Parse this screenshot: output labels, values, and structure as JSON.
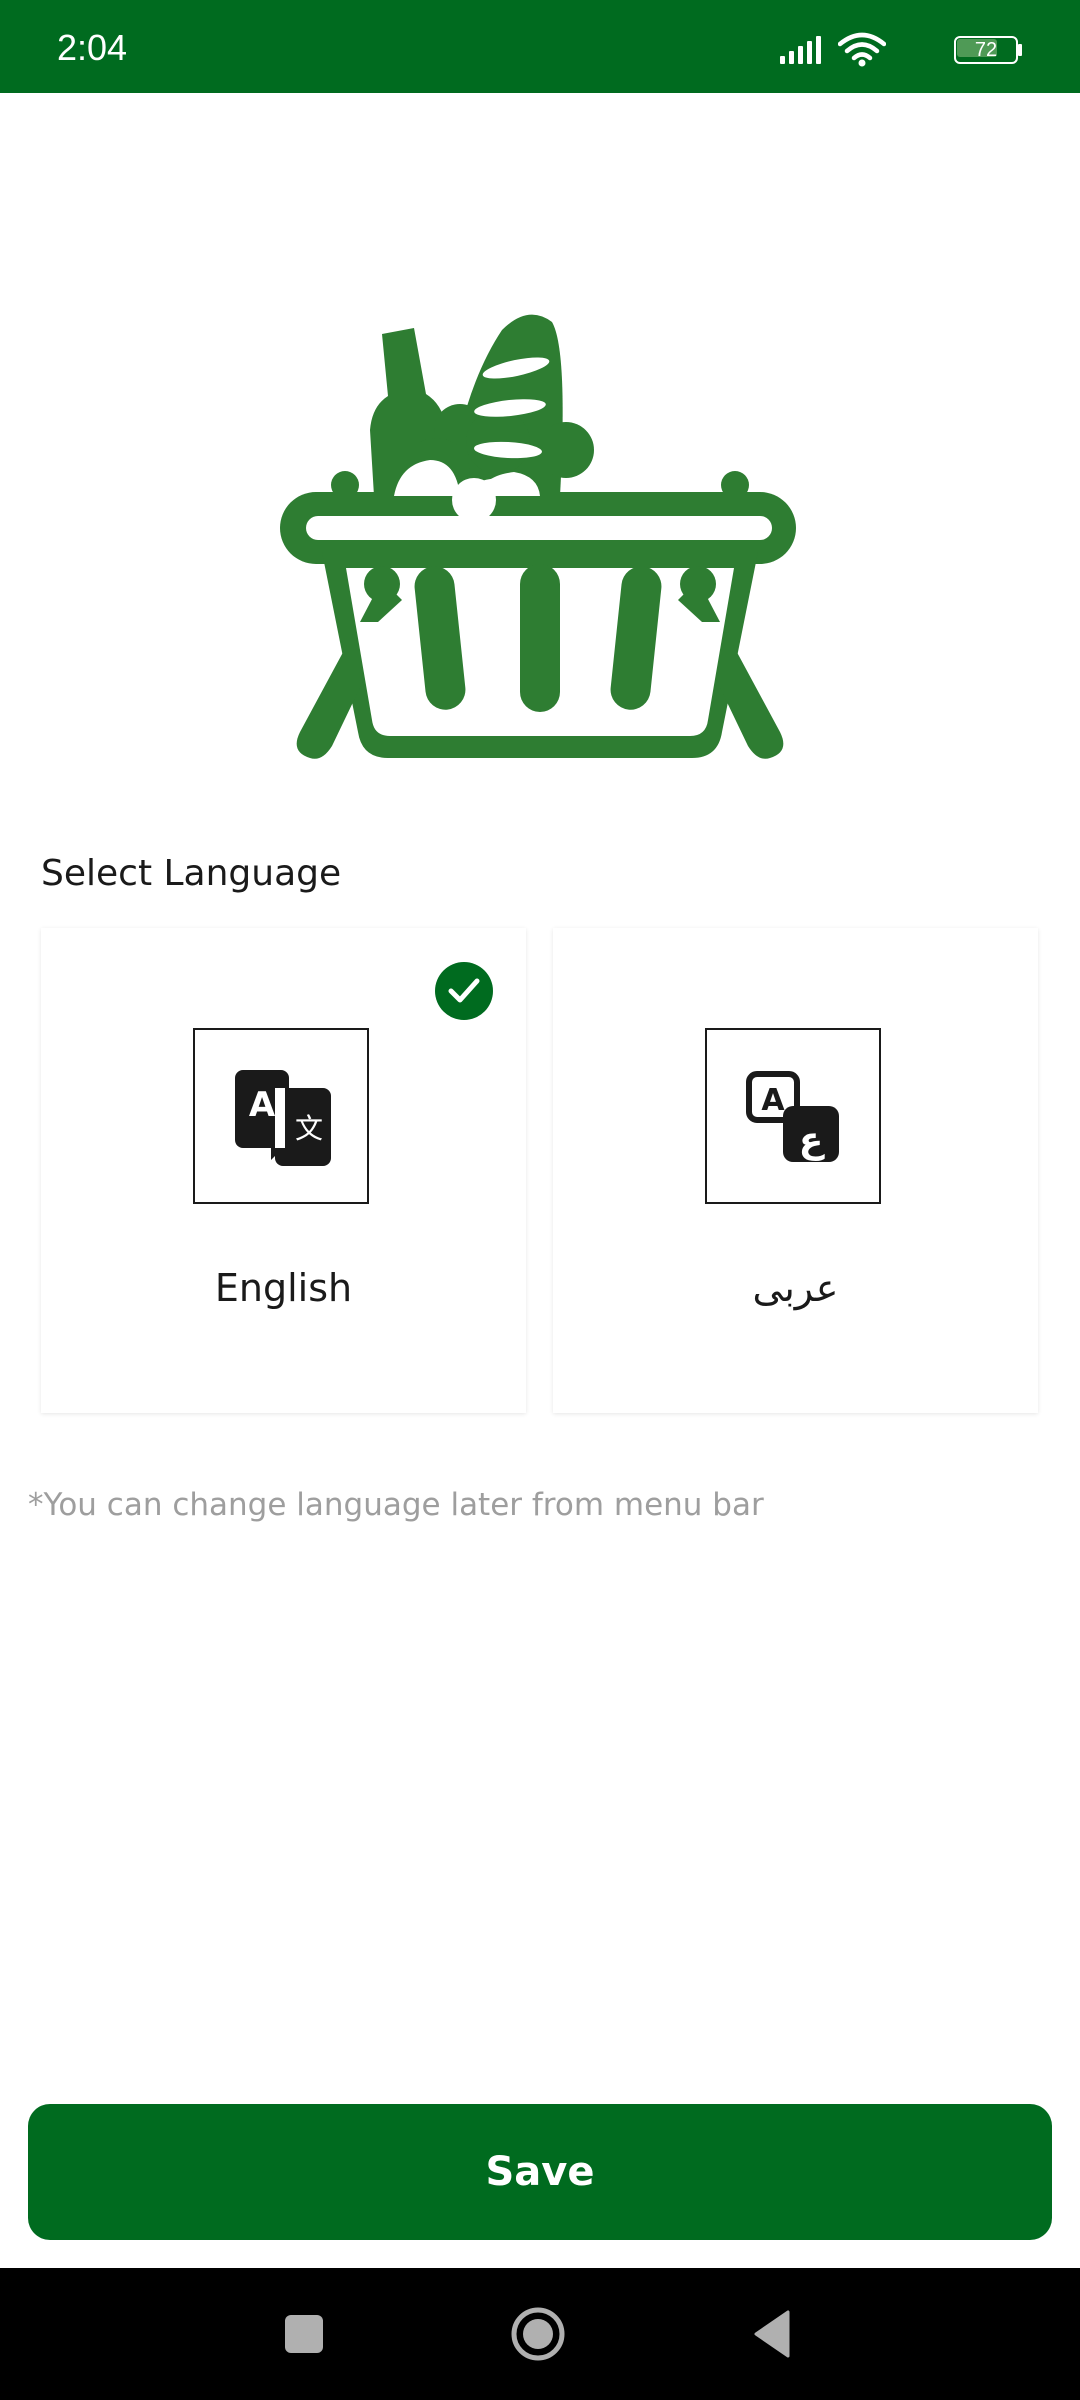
{
  "status_bar": {
    "time": "2:04",
    "battery_level": "72",
    "icons": [
      "signal-icon",
      "wifi-icon",
      "battery-icon"
    ]
  },
  "language_section": {
    "title": "Select Language",
    "options": [
      {
        "label": "English",
        "icon": "translate-icon",
        "selected": true
      },
      {
        "label": "عربى",
        "icon": "arabic-translate-icon",
        "selected": false
      }
    ],
    "note": "*You can change language later from menu bar"
  },
  "save_button": {
    "label": "Save"
  },
  "nav_bar": {
    "icons": [
      "recent-apps-icon",
      "home-icon",
      "back-icon"
    ]
  },
  "colors": {
    "primary": "#006b1f",
    "logo_green": "#2e7d32",
    "note_text": "#9e9e9e"
  }
}
